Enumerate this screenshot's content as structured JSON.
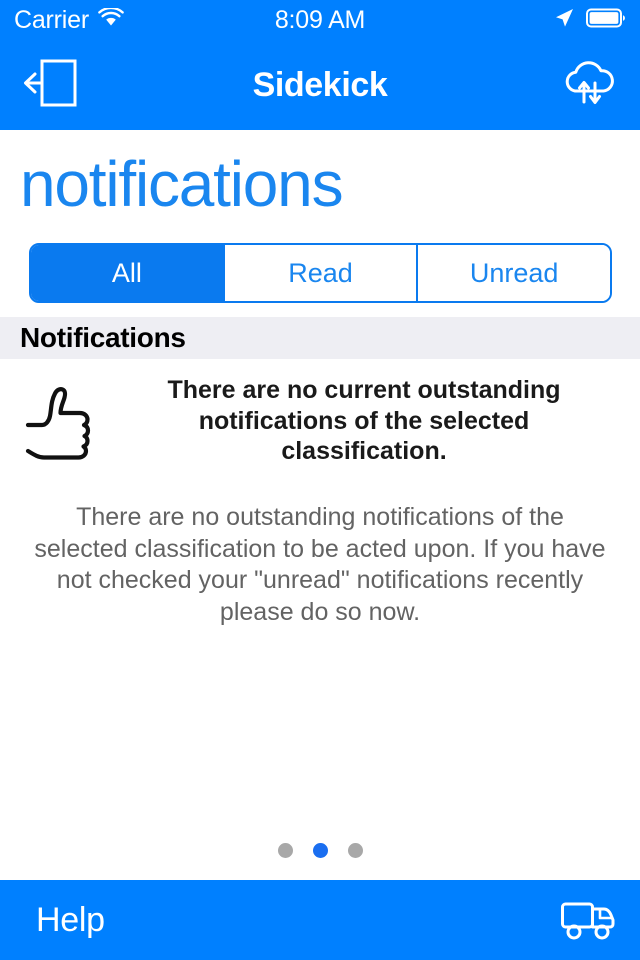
{
  "status_bar": {
    "carrier": "Carrier",
    "time": "8:09 AM",
    "wifi_icon": "wifi-icon",
    "location_icon": "location-arrow-icon",
    "battery_icon": "battery-icon",
    "background_color": "#0080ff",
    "text_color": "#ffffff"
  },
  "nav_bar": {
    "title": "Sidekick",
    "back_icon": "exit-left-arrow-icon",
    "sync_icon": "cloud-sync-icon",
    "background_color": "#0080ff"
  },
  "page": {
    "heading": "notifications",
    "heading_color": "#1a86ef"
  },
  "segmented_control": {
    "selected": "All",
    "accent_color": "#0a7aef",
    "options": [
      {
        "label": "All",
        "selected": true
      },
      {
        "label": "Read",
        "selected": false
      },
      {
        "label": "Unread",
        "selected": false
      }
    ]
  },
  "section": {
    "header": "Notifications",
    "header_background": "#eeeef3"
  },
  "empty_state": {
    "icon": "thumbs-up-icon",
    "headline": "There are no current outstanding notifications of the selected classification.",
    "body": "There are no outstanding notifications of the selected classification to be acted upon. If you have not checked your \"unread\" notifications recently please do so now.",
    "headline_color": "#1a1a1a",
    "body_color": "#636363"
  },
  "page_indicator": {
    "total": 3,
    "active_index": 1,
    "active_color": "#1a6ef0",
    "inactive_color": "#a8a8a8"
  },
  "bottom_bar": {
    "help_label": "Help",
    "truck_icon": "delivery-truck-icon",
    "background_color": "#0080ff"
  }
}
